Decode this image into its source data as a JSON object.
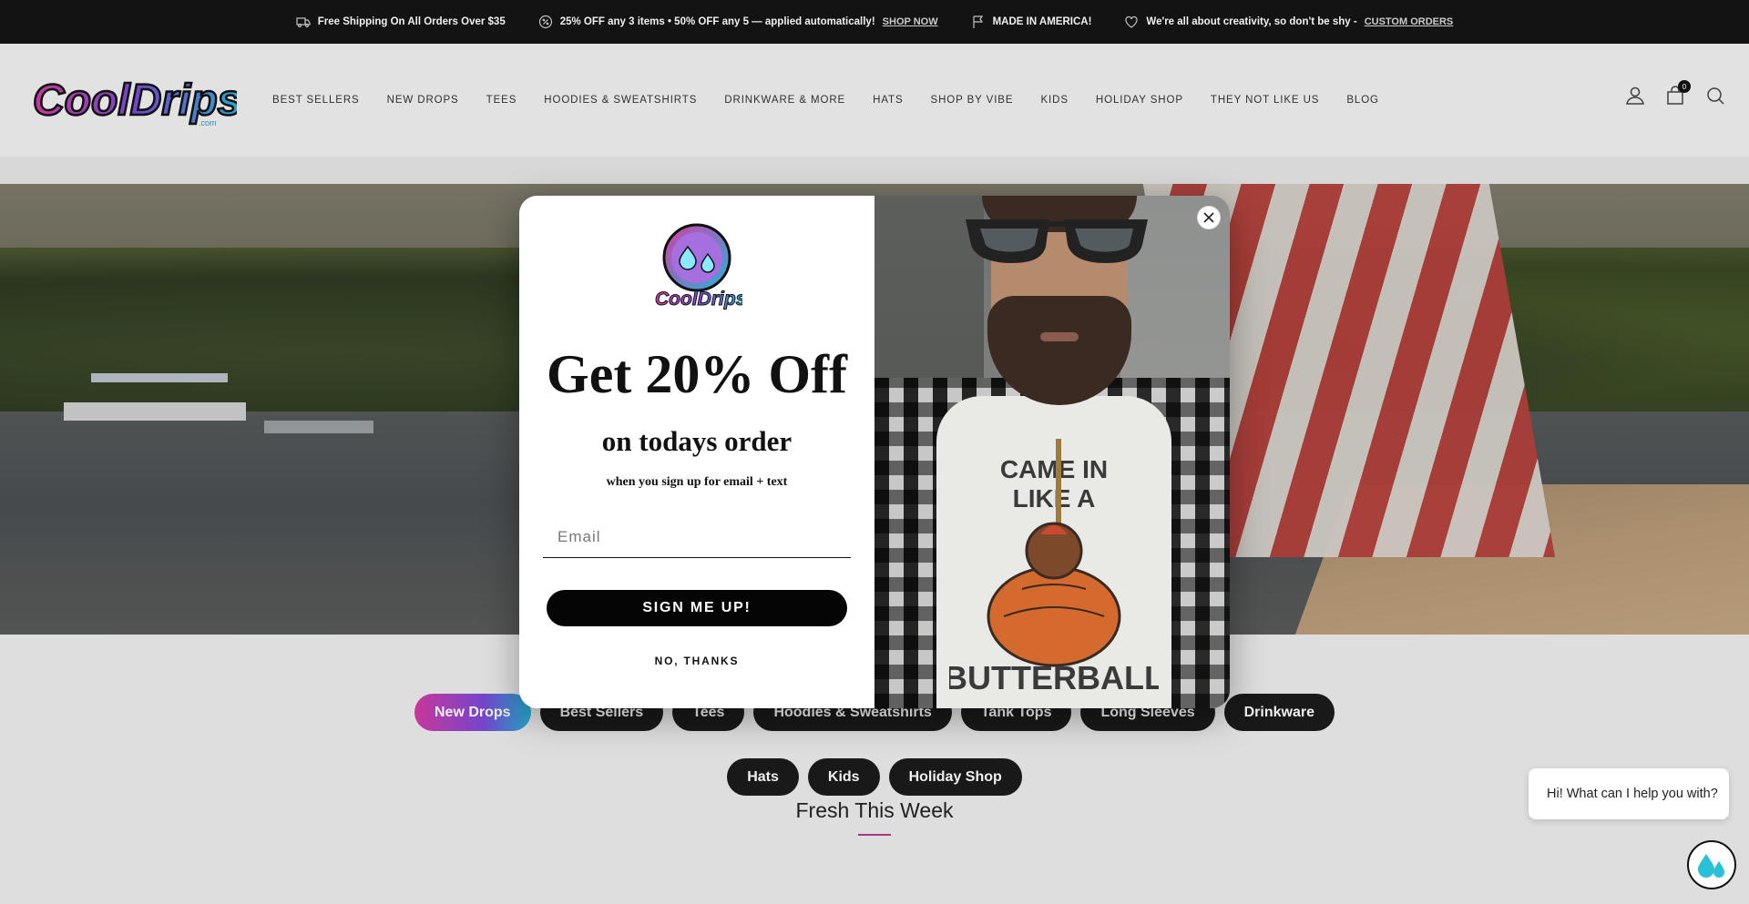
{
  "announcement": {
    "shipping": "Free Shipping On All Orders Over $35",
    "promo": "25% OFF any 3 items • 50% OFF any 5 — applied automatically!",
    "promo_link": "SHOP NOW",
    "made_in": "MADE IN AMERICA!",
    "creativity": "We're all about creativity, so don't be shy -",
    "custom_link": "CUSTOM ORDERS"
  },
  "header": {
    "nav": [
      "BEST SELLERS",
      "NEW DROPS",
      "TEES",
      "HOODIES & SWEATSHIRTS",
      "DRINKWARE & MORE",
      "HATS",
      "SHOP BY VIBE",
      "KIDS",
      "HOLIDAY SHOP",
      "THEY NOT LIKE US",
      "BLOG"
    ],
    "cart_count": "0"
  },
  "pills": [
    "New Drops",
    "Best Sellers",
    "Tees",
    "Hoodies & Sweatshirts",
    "Tank Tops",
    "Long Sleeves",
    "Drinkware",
    "Hats",
    "Kids",
    "Holiday Shop"
  ],
  "section_title": "Fresh This Week",
  "popup": {
    "headline": "Get 20% Off",
    "subhead": "on todays order",
    "note": "when you sign up for email + text",
    "email_placeholder": "Email",
    "signup_label": "SIGN ME UP!",
    "decline_label": "NO, THANKS",
    "shirt_text": [
      "CAME IN",
      "LIKE A",
      "BUTTERBALL"
    ]
  },
  "chat": {
    "greeting": "Hi! What can I help you with?"
  },
  "colors": {
    "brand_pink": "#d43ca6",
    "brand_purple": "#7a4bd8",
    "brand_cyan": "#27b5d8",
    "dark": "#151515"
  }
}
